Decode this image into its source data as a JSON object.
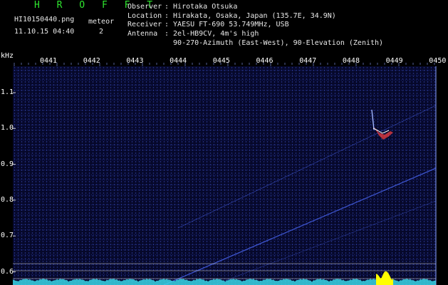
{
  "header": {
    "brand": "H R O F F T",
    "filename": "HI10150440.png",
    "datetime": "11.10.15 04:40",
    "meteor_label": "meteor",
    "meteor_count": "2",
    "info_rows": [
      {
        "key": "Observer",
        "value": ": Hirotaka Otsuka"
      },
      {
        "key": "Location",
        "value": ": Hirakata, Osaka, Japan (135.7E, 34.9N)"
      },
      {
        "key": "Receiver",
        "value": ": YAESU FT-690 53.749MHz, USB"
      },
      {
        "key": "Antenna",
        "value": ": 2el-HB9CV, 4m's high"
      },
      {
        "key": "",
        "value": "  90-270-Azimuth (East-West), 90-Elevation (Zenith)"
      }
    ]
  },
  "axis": {
    "unit_label": "kHz",
    "time_ticks": [
      "0441",
      "0442",
      "0443",
      "0444",
      "0445",
      "0446",
      "0447",
      "0448",
      "0449",
      "0450"
    ],
    "freq_ticks": [
      "1.1",
      "1.0",
      "0.9",
      "0.8",
      "0.7",
      "0.6"
    ]
  },
  "colors": {
    "background": "#000000",
    "brand": "#2fe62f",
    "text": "#e8e8e8",
    "signal": "#4d6bff",
    "echo_red": "#ff4040",
    "spectrum": "#39d6e6",
    "peak": "#ffff00"
  }
}
